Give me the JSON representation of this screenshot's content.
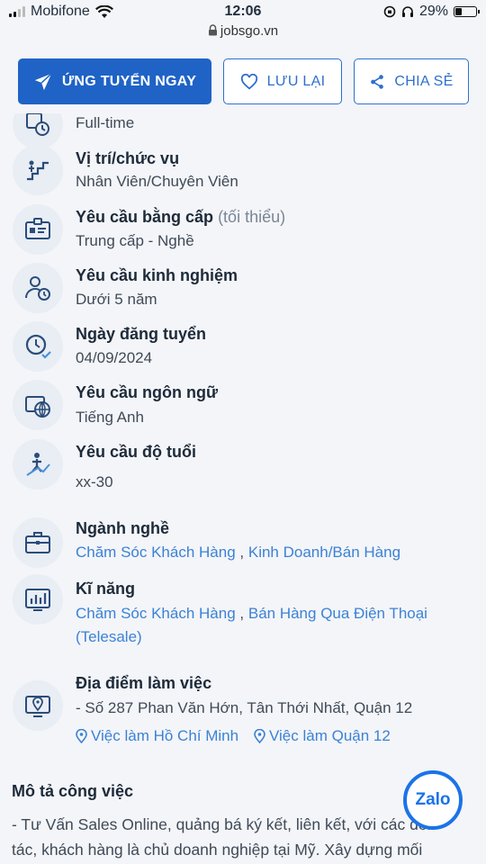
{
  "status_bar": {
    "carrier": "Mobifone",
    "time": "12:06",
    "battery_level": "29%",
    "battery_fraction": 0.29
  },
  "browser": {
    "url": "jobsgo.vn"
  },
  "actions": {
    "apply_label": "ỨNG TUYỂN NGAY",
    "save_label": "LƯU LẠI",
    "share_label": "CHIA SẺ",
    "accent_color": "#1f63c6"
  },
  "job_info": [
    {
      "title": "",
      "value": "Full-time",
      "icon": "clock-calendar-icon"
    },
    {
      "title": "Vị trí/chức vụ",
      "value": "Nhân Viên/Chuyên Viên",
      "icon": "career-stairs-icon"
    },
    {
      "title": "Yêu cầu bằng cấp",
      "title_note": "(tối thiểu)",
      "value": "Trung cấp - Nghề",
      "icon": "id-card-icon"
    },
    {
      "title": "Yêu cầu kinh nghiệm",
      "value": "Dưới 5 năm",
      "icon": "user-clock-icon"
    },
    {
      "title": "Ngày đăng tuyển",
      "value": "04/09/2024",
      "icon": "clock-check-icon"
    },
    {
      "title": "Yêu cầu ngôn ngữ",
      "value": "Tiếng Anh",
      "icon": "language-globe-icon"
    },
    {
      "title": "Yêu cầu độ tuổi",
      "value": "xx-30",
      "icon": "person-growth-icon"
    }
  ],
  "industry": {
    "title": "Ngành nghề",
    "links": [
      "Chăm Sóc Khách Hàng",
      "Kinh Doanh/Bán Hàng"
    ],
    "separator": ","
  },
  "skills": {
    "title": "Kĩ năng",
    "line1": [
      "Chăm Sóc Khách Hàng",
      "Bán Hàng Qua Điện Thoại"
    ],
    "line2": "(Telesale)",
    "separator": ","
  },
  "location": {
    "title": "Địa điểm làm việc",
    "address": "- Số 287 Phan Văn Hớn, Tân Thới Nhất, Quận 12",
    "links": [
      "Việc làm Hồ Chí Minh",
      "Việc làm Quận 12"
    ]
  },
  "description": {
    "title": "Mô tả công việc",
    "lines": [
      "- Tư Vấn Sales Online, quảng bá ký kết, liên kết, với các đối",
      "tác, khách hàng là chủ doanh nghiệp tại Mỹ. Xây dựng mối"
    ]
  },
  "zalo": {
    "label": "Zalo"
  }
}
